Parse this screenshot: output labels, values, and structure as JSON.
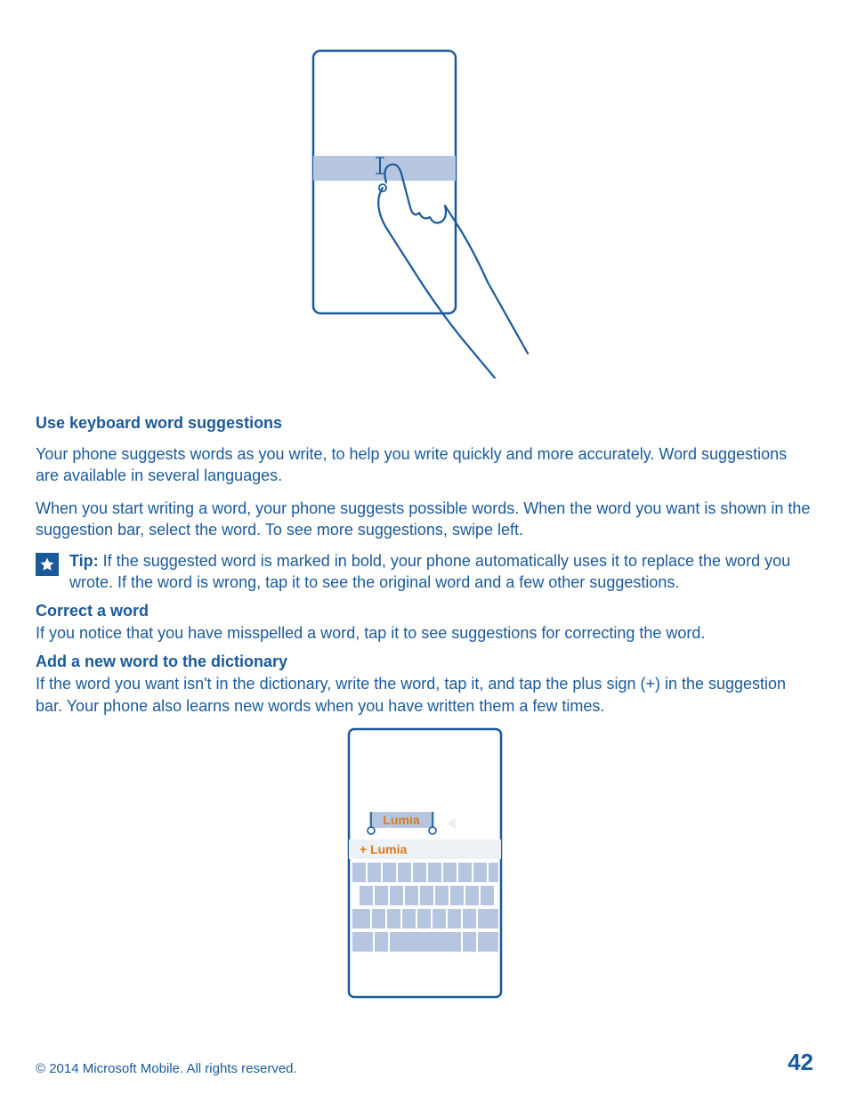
{
  "illustration2": {
    "highlighted_word": "Lumia",
    "suggestion": "+ Lumia"
  },
  "headings": {
    "use_suggestions": "Use keyboard word suggestions",
    "correct_word": "Correct a word",
    "add_word": "Add a new word to the dictionary"
  },
  "paragraphs": {
    "intro": "Your phone suggests words as you write, to help you write quickly and more accurately. Word suggestions are available in several languages.",
    "swipe": "When you start writing a word, your phone suggests possible words. When the word you want is shown in the suggestion bar, select the word. To see more suggestions, swipe left.",
    "correct": "If you notice that you have misspelled a word, tap it to see suggestions for correcting the word.",
    "add": "If the word you want isn't in the dictionary, write the word, tap it, and tap the plus sign (+) in the suggestion bar. Your phone also learns new words when you have written them a few times."
  },
  "tip": {
    "label": "Tip:",
    "text": " If the suggested word is marked in bold, your phone automatically uses it to replace the word you wrote. If the word is wrong, tap it to see the original word and a few other suggestions."
  },
  "footer": {
    "copyright": "© 2014 Microsoft Mobile. All rights reserved.",
    "page": "42"
  }
}
